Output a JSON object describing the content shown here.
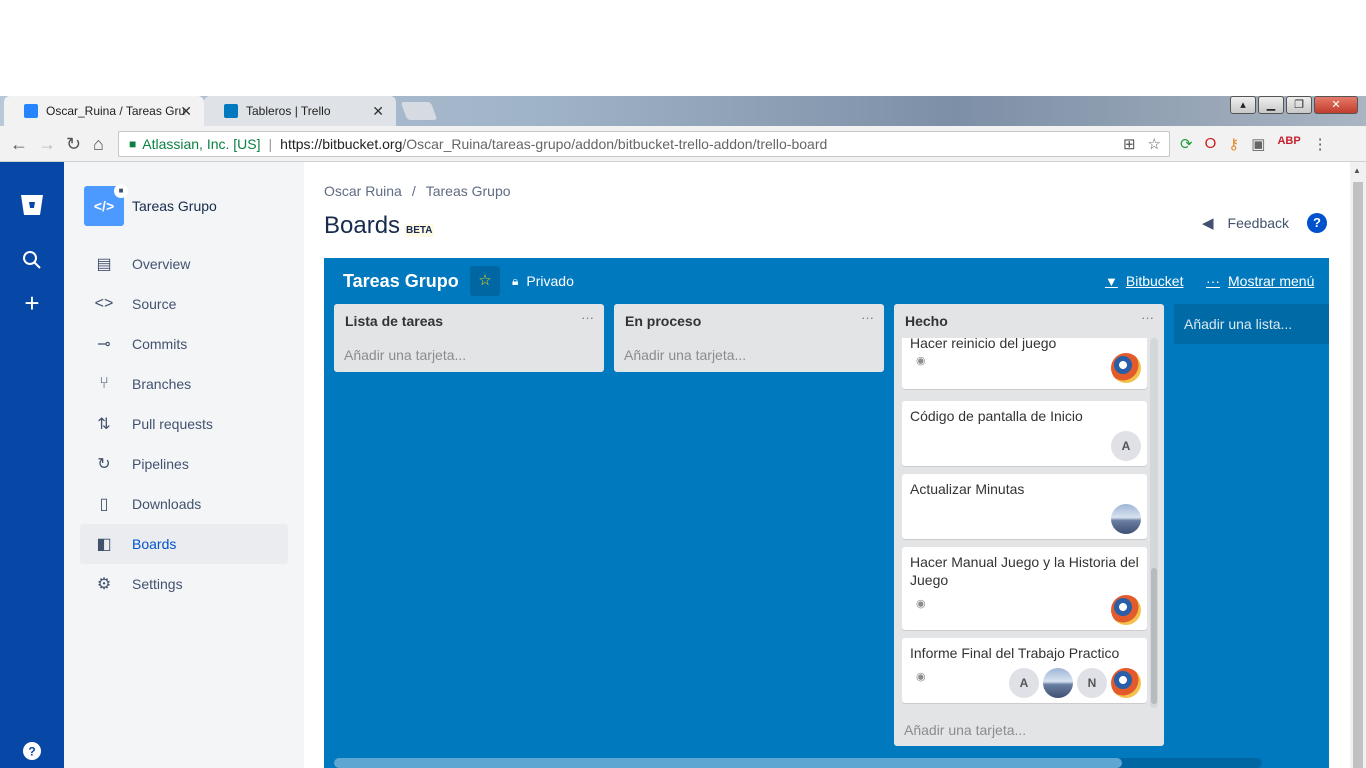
{
  "browser": {
    "tabs": [
      {
        "title": "Oscar_Ruina / Tareas Grupo",
        "active": true,
        "favicon_color": "#2684ff"
      },
      {
        "title": "Tableros | Trello",
        "active": false,
        "favicon_color": "#0079bf"
      }
    ],
    "close_glyph": "✕",
    "window_buttons": [
      "▴",
      "▁",
      "❐",
      "✕"
    ],
    "security_org": "Atlassian, Inc. [US]",
    "url_scheme_host": "https://bitbucket.org",
    "url_path": "/Oscar_Ruina/tareas-grupo/addon/bitbucket-trello-addon/trello-board",
    "extension_icons": [
      "refresh-sync-icon",
      "opera-icon",
      "key-icon",
      "shopping-bag-icon",
      "adblock-icon",
      "more-icon"
    ]
  },
  "repo": {
    "name": "Tareas Grupo",
    "avatar_glyph": "</>",
    "nav": [
      {
        "label": "Overview",
        "icon": "overview-icon",
        "selected": false
      },
      {
        "label": "Source",
        "icon": "source-icon",
        "selected": false
      },
      {
        "label": "Commits",
        "icon": "commits-icon",
        "selected": false
      },
      {
        "label": "Branches",
        "icon": "branches-icon",
        "selected": false
      },
      {
        "label": "Pull requests",
        "icon": "pull-requests-icon",
        "selected": false
      },
      {
        "label": "Pipelines",
        "icon": "pipelines-icon",
        "selected": false
      },
      {
        "label": "Downloads",
        "icon": "downloads-icon",
        "selected": false
      },
      {
        "label": "Boards",
        "icon": "boards-icon",
        "selected": true
      },
      {
        "label": "Settings",
        "icon": "settings-icon",
        "selected": false
      }
    ]
  },
  "breadcrumb": {
    "owner": "Oscar Ruina",
    "separator": "/",
    "repo": "Tareas Grupo"
  },
  "page": {
    "title": "Boards",
    "badge": "BETA",
    "feedback": "Feedback",
    "help": "?"
  },
  "board": {
    "name": "Tareas Grupo",
    "visibility": "Privado",
    "bitbucket_link": "Bitbucket",
    "menu_link": "Mostrar menú",
    "add_list": "Añadir una lista...",
    "lists": [
      {
        "title": "Lista de tareas",
        "add_card": "Añadir una tarjeta...",
        "cards": []
      },
      {
        "title": "En proceso",
        "add_card": "Añadir una tarjeta...",
        "cards": []
      },
      {
        "title": "Hecho",
        "add_card": "Añadir una tarjeta...",
        "cards": [
          {
            "title": "Hacer reinicio del juego",
            "watched": true,
            "members": [
              "pic1"
            ]
          },
          {
            "title": "Código de pantalla de Inicio",
            "watched": false,
            "members": [
              "A"
            ]
          },
          {
            "title": "Actualizar Minutas",
            "watched": false,
            "members": [
              "pic2"
            ]
          },
          {
            "title": "Hacer Manual Juego y la Historia del Juego",
            "watched": true,
            "members": [
              "pic1"
            ]
          },
          {
            "title": "Informe Final del Trabajo Practico",
            "watched": true,
            "members": [
              "A",
              "pic2",
              "N",
              "pic1"
            ]
          }
        ]
      }
    ]
  },
  "colors": {
    "global_nav": "#0747a6",
    "board_bg": "#0079bf",
    "link_blue": "#0052cc",
    "star": "#f2d600"
  }
}
